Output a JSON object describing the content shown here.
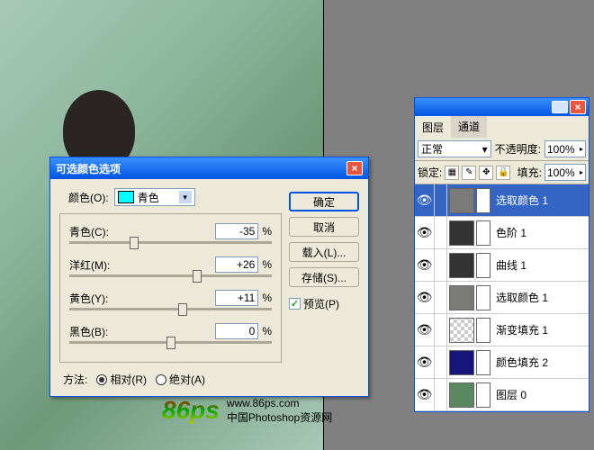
{
  "dialog": {
    "title": "可选颜色选项",
    "color_label": "颜色(O):",
    "color_name": "青色",
    "sliders": [
      {
        "label": "青色(C):",
        "value": "-35",
        "unit": "%",
        "pos": 32
      },
      {
        "label": "洋红(M):",
        "value": "+26",
        "unit": "%",
        "pos": 63
      },
      {
        "label": "黄色(Y):",
        "value": "+11",
        "unit": "%",
        "pos": 56
      },
      {
        "label": "黑色(B):",
        "value": "0",
        "unit": "%",
        "pos": 50
      }
    ],
    "method_label": "方法:",
    "method_rel": "相对(R)",
    "method_abs": "绝对(A)",
    "btn_ok": "确定",
    "btn_cancel": "取消",
    "btn_load": "载入(L)...",
    "btn_save": "存储(S)...",
    "preview": "预览(P)"
  },
  "layers": {
    "tab1": "图层",
    "tab2": "通道",
    "blend": "正常",
    "opacity_label": "不透明度:",
    "opacity": "100%",
    "lock_label": "锁定:",
    "fill_label": "填充:",
    "fill": "100%",
    "items": [
      {
        "name": "选取颜色 1",
        "sel": true,
        "thumb": "#7a7a78"
      },
      {
        "name": "色阶 1",
        "thumb": "#333"
      },
      {
        "name": "曲线 1",
        "thumb": "#333"
      },
      {
        "name": "选取颜色 1",
        "thumb": "#7a7a78"
      },
      {
        "name": "渐变填充 1",
        "thumb": "checker"
      },
      {
        "name": "颜色填充 2",
        "thumb": "#15157a"
      },
      {
        "name": "图层 0",
        "thumb": "#5a8860"
      }
    ]
  },
  "watermark": {
    "brand": "86ps",
    "url": "www.86ps.com",
    "sub": "中国Photoshop资源网"
  }
}
